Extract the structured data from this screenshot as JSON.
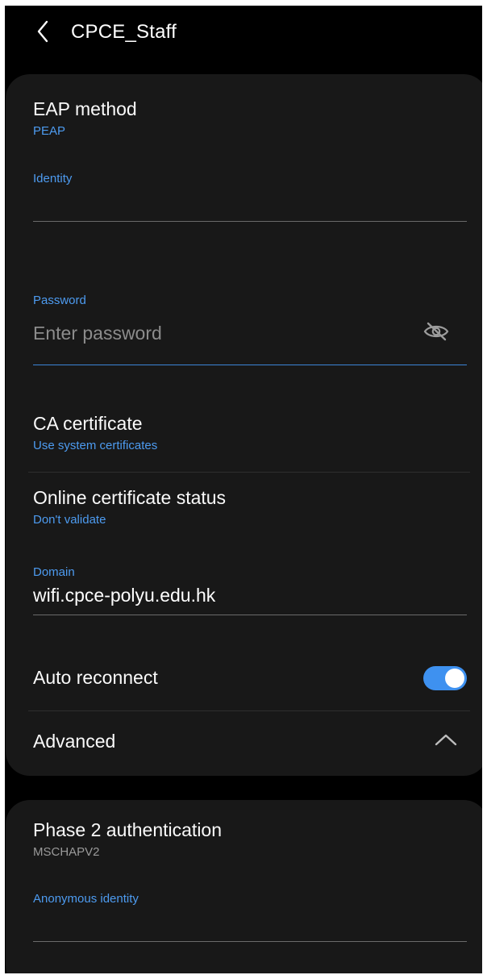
{
  "header": {
    "title": "CPCE_Staff",
    "back_icon": "chevron-left-icon"
  },
  "eap": {
    "label": "EAP method",
    "value": "PEAP"
  },
  "identity": {
    "label": "Identity",
    "value": ""
  },
  "password": {
    "label": "Password",
    "placeholder": "Enter password",
    "value": "",
    "visibility_icon": "eye-off-icon"
  },
  "ca_certificate": {
    "label": "CA certificate",
    "value": "Use system certificates"
  },
  "online_status": {
    "label": "Online certificate status",
    "value": "Don't validate"
  },
  "domain": {
    "label": "Domain",
    "value": "wifi.cpce-polyu.edu.hk"
  },
  "auto_reconnect": {
    "label": "Auto reconnect",
    "enabled": true
  },
  "advanced": {
    "label": "Advanced",
    "icon": "chevron-up-icon"
  },
  "phase2": {
    "label": "Phase 2 authentication",
    "value": "MSCHAPV2"
  },
  "anonymous_identity": {
    "label": "Anonymous identity",
    "value": ""
  },
  "colors": {
    "accent": "#4d9bf0",
    "toggle_on": "#3e91f0",
    "background": "#000000",
    "card": "#181818"
  }
}
